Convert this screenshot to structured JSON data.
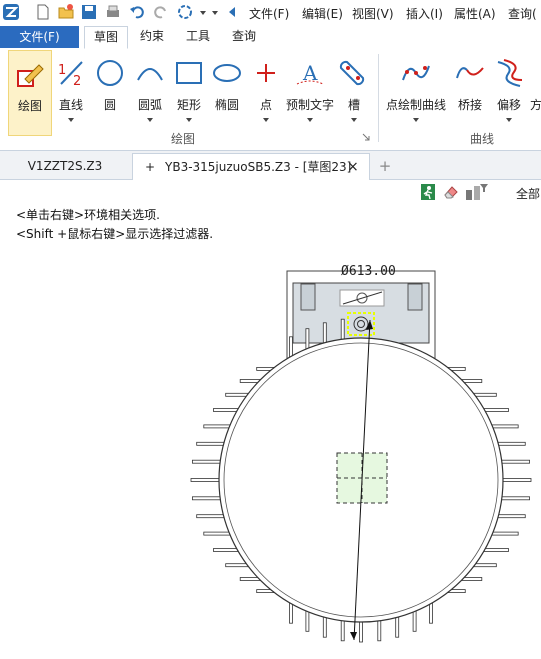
{
  "menu": {
    "file": "文件(F)",
    "edit": "编辑(E)",
    "view": "视图(V)",
    "insert": "插入(I)",
    "attr": "属性(A)",
    "query": "查询("
  },
  "tabs": {
    "file_button": "文件(F)",
    "items": [
      "草图",
      "约束",
      "工具",
      "查询"
    ]
  },
  "ribbon": {
    "tools": [
      "绘图",
      "直线",
      "圆",
      "圆弧",
      "矩形",
      "椭圆",
      "点",
      "预制文字",
      "槽",
      "点绘制曲线",
      "桥接",
      "偏移",
      "方"
    ],
    "group_draw": "绘图",
    "group_curve": "曲线"
  },
  "doctabs": {
    "tab1": "V1ZZT2S.Z3",
    "tab2_prefix": "+",
    "tab2": "YB3-315juzuoSB5.Z3 - [草图23]",
    "close": "×",
    "add": "+"
  },
  "canvas": {
    "hint1": "<单击右键>环境相关选项.",
    "hint2": "<Shift +鼠标右键>显示选择过滤器.",
    "filter_label": "全部",
    "dimension": "Ø613.00"
  },
  "colors": {
    "accent": "#2b6bbf",
    "red_icon": "#d0201b",
    "blue_icon": "#2a6fb5",
    "selection": "#e8ff00",
    "fill_green": "#e6f8e0"
  }
}
